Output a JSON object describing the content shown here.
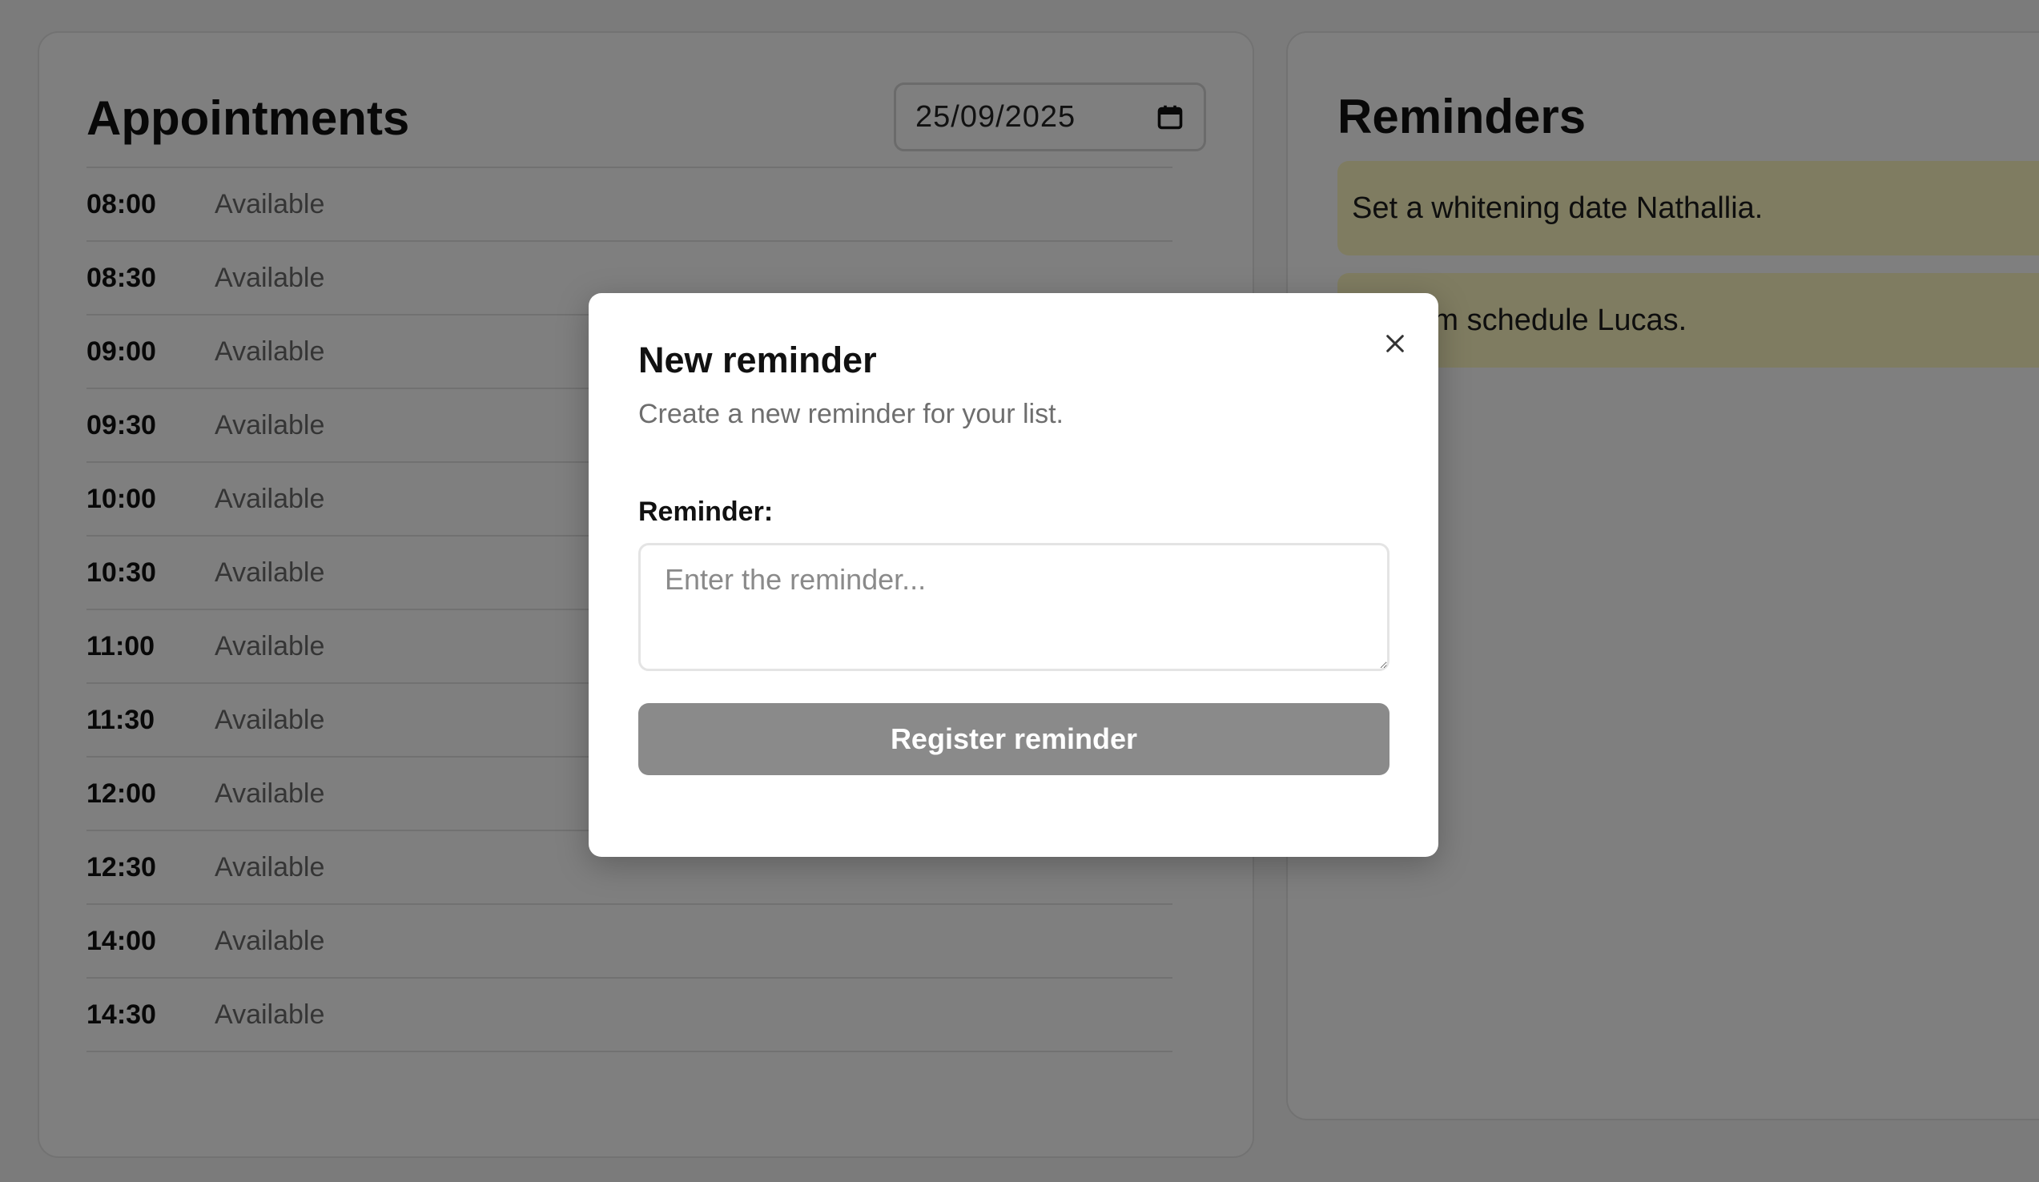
{
  "appointments": {
    "title": "Appointments",
    "date_value": "25/09/2025",
    "slots": [
      {
        "time": "08:00",
        "status": "Available"
      },
      {
        "time": "08:30",
        "status": "Available"
      },
      {
        "time": "09:00",
        "status": "Available"
      },
      {
        "time": "09:30",
        "status": "Available"
      },
      {
        "time": "10:00",
        "status": "Available"
      },
      {
        "time": "10:30",
        "status": "Available"
      },
      {
        "time": "11:00",
        "status": "Available"
      },
      {
        "time": "11:30",
        "status": "Available"
      },
      {
        "time": "12:00",
        "status": "Available"
      },
      {
        "time": "12:30",
        "status": "Available"
      },
      {
        "time": "14:00",
        "status": "Available"
      },
      {
        "time": "14:30",
        "status": "Available"
      }
    ]
  },
  "reminders": {
    "title": "Reminders",
    "items": [
      {
        "text": "Set a whitening date Nathallia."
      },
      {
        "text": "Confirm schedule Lucas."
      }
    ],
    "item_color": "#fef9c2"
  },
  "modal": {
    "title": "New reminder",
    "subtitle": "Create a new reminder for your list.",
    "field_label": "Reminder:",
    "input_value": "",
    "input_placeholder": "Enter the reminder...",
    "submit_label": "Register reminder",
    "close_icon": "close-icon",
    "submit_color": "#8a8a8a"
  },
  "icons": {
    "date_picker": "calendar-icon"
  }
}
